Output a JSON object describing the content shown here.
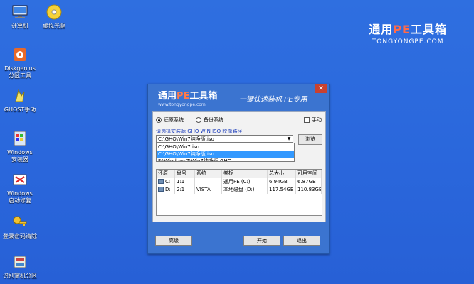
{
  "desktop": {
    "icons": [
      {
        "label": "计算机",
        "icon": "computer-icon"
      },
      {
        "label": "虚拟光驱",
        "icon": "cd-drive-icon"
      },
      {
        "label": "Diskgenius\n分区工具",
        "icon": "diskgenius-icon"
      },
      {
        "label": "GHOST手动",
        "icon": "ghost-icon"
      },
      {
        "label": "Windows\n安装器",
        "icon": "windows-installer-icon"
      },
      {
        "label": "Windows\n启动修复",
        "icon": "boot-repair-icon"
      },
      {
        "label": "登录密码清除",
        "icon": "key-icon"
      },
      {
        "label": "识别掌机分区",
        "icon": "partition-icon"
      }
    ]
  },
  "brand": {
    "title_pre": "通用",
    "title_pe": "PE",
    "title_post": "工具箱",
    "url": "TONGYONGPE.COM"
  },
  "window": {
    "title_pre": "通用",
    "title_pe": "PE",
    "title_post": "工具箱",
    "url": "www.tongyongpe.com",
    "subtitle": "一键快速装机  PE专用",
    "close": "✕",
    "restore_label": "还原系统",
    "backup_label": "备份系统",
    "manual_label": "手动",
    "prompt": "请选择安装源 GHO WIN ISO 映像路径",
    "combo_value": "C:\\GHO\\Win7纯净版.iso",
    "browse_label": "浏览",
    "dropdown": [
      "C:\\GHO\\Win7.iso",
      "C:\\GHO\\Win7纯净版.iso",
      "F:\\Windows7\\Win7纯净版.GHO"
    ],
    "table": {
      "headers": [
        "还原",
        "盘号",
        "系统",
        "卷标",
        "总大小",
        "可用空间"
      ],
      "rows": [
        [
          "C:",
          "1:1",
          "",
          "通用PE (C:)",
          "6.94GB",
          "6.87GB"
        ],
        [
          "D:",
          "2:1",
          "VISTA",
          "本地磁盘 (D:)",
          "117.54GB",
          "110.83GB"
        ]
      ]
    },
    "advanced_label": "高级",
    "start_label": "开始",
    "exit_label": "退出"
  }
}
